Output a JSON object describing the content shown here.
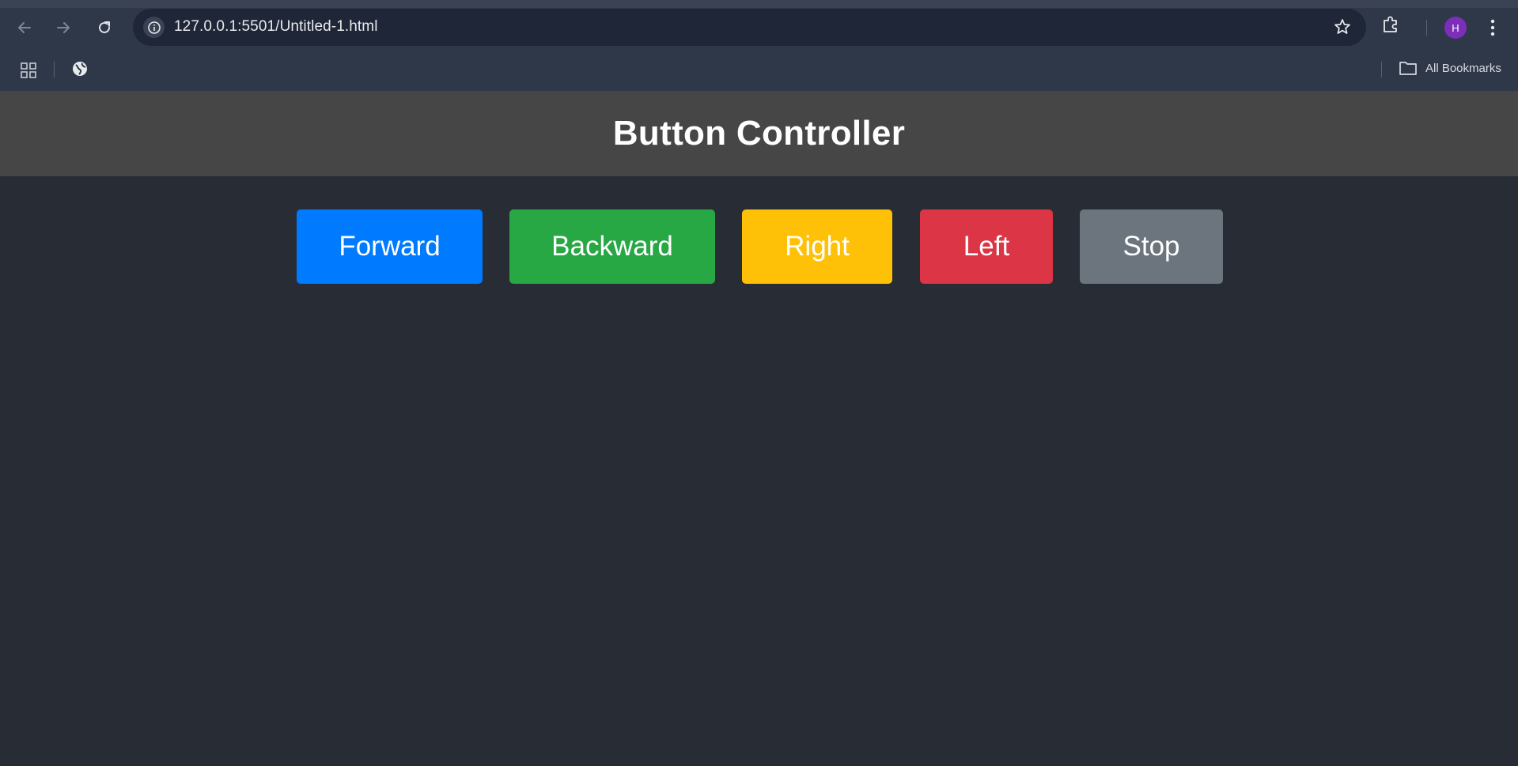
{
  "browser": {
    "url": "127.0.0.1:5501/Untitled-1.html",
    "avatar_initial": "H",
    "bookmarks_label": "All Bookmarks",
    "icons": [
      "back-icon",
      "forward-icon",
      "reload-icon",
      "site-info-icon",
      "star-icon",
      "extensions-icon",
      "menu-icon",
      "apps-icon",
      "globe-icon",
      "folder-icon"
    ]
  },
  "page": {
    "title": "Button Controller",
    "buttons": [
      {
        "label": "Forward",
        "color": "#007bff"
      },
      {
        "label": "Backward",
        "color": "#28a745"
      },
      {
        "label": "Right",
        "color": "#ffc107"
      },
      {
        "label": "Left",
        "color": "#dc3545"
      },
      {
        "label": "Stop",
        "color": "#6c757d"
      }
    ],
    "colors": {
      "header_bg": "#464646",
      "body_bg": "#282c34"
    }
  }
}
